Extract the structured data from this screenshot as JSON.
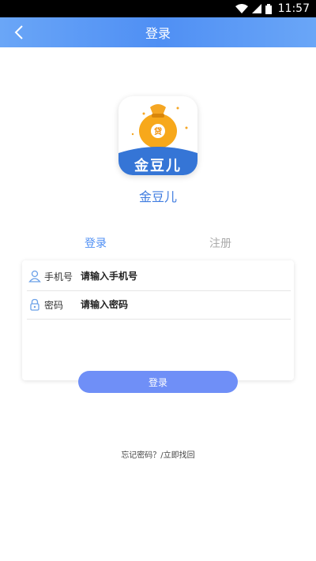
{
  "status_bar": {
    "time": "11:57"
  },
  "nav": {
    "title": "登录",
    "back_icon": "chevron-left-icon"
  },
  "app": {
    "name": "金豆儿",
    "icon_text": "金豆儿",
    "bag_badge": "贷",
    "brand_color": "#4f8ff4"
  },
  "tabs": [
    {
      "label": "登录",
      "active": true
    },
    {
      "label": "注册",
      "active": false
    }
  ],
  "form": {
    "phone_label": "手机号",
    "phone_placeholder": "请输入手机号",
    "password_label": "密码",
    "password_placeholder": "请输入密码"
  },
  "login_button": "登录",
  "forgot_link": "忘记密码？/立即找回"
}
